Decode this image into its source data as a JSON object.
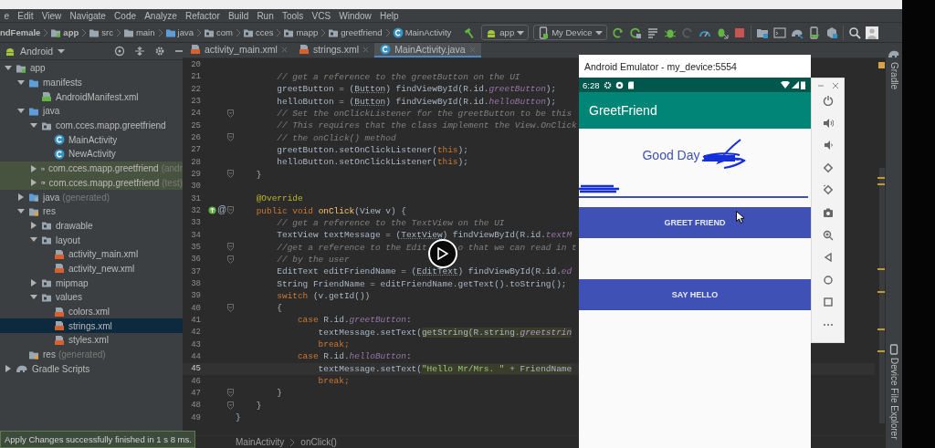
{
  "menu": [
    "e",
    "Edit",
    "View",
    "Navigate",
    "Code",
    "Analyze",
    "Refactor",
    "Build",
    "Run",
    "Tools",
    "VCS",
    "Window",
    "Help"
  ],
  "breadcrumbs": [
    {
      "label": "ndFemale",
      "kind": "project"
    },
    {
      "label": "app",
      "kind": "module"
    },
    {
      "label": "src",
      "kind": "folder"
    },
    {
      "label": "main",
      "kind": "folder"
    },
    {
      "label": "java",
      "kind": "source"
    },
    {
      "label": "com",
      "kind": "package"
    },
    {
      "label": "cces",
      "kind": "package"
    },
    {
      "label": "mapp",
      "kind": "package"
    },
    {
      "label": "greetfriend",
      "kind": "package"
    },
    {
      "label": "MainActivity",
      "kind": "class"
    }
  ],
  "toolbar": {
    "configuration": "app",
    "device": "My Device"
  },
  "project_panel": {
    "view": "Android",
    "tree": [
      {
        "label": "app",
        "kind": "module",
        "expanded": true,
        "selected": false,
        "children": [
          {
            "label": "manifests",
            "kind": "folder",
            "expanded": true,
            "selected": false,
            "children": [
              {
                "label": "AndroidManifest.xml",
                "kind": "manifest",
                "selected": false
              }
            ]
          },
          {
            "label": "java",
            "kind": "folder",
            "expanded": true,
            "selected": false,
            "children": [
              {
                "label": "com.cces.mapp.greetfriend",
                "kind": "package",
                "expanded": true,
                "selected": false,
                "children": [
                  {
                    "label": "MainActivity",
                    "kind": "class",
                    "selected": false
                  },
                  {
                    "label": "NewActivity",
                    "kind": "class",
                    "selected": false
                  }
                ]
              },
              {
                "label": "com.cces.mapp.greetfriend",
                "suffix": "(andr",
                "kind": "test_package",
                "expanded": false,
                "selected": false
              },
              {
                "label": "com.cces.mapp.greetfriend",
                "suffix": "(test)",
                "kind": "test_package",
                "expanded": false,
                "selected": false
              }
            ]
          },
          {
            "label": "java",
            "suffix": "(generated)",
            "kind": "generated",
            "expanded": false,
            "selected": false
          },
          {
            "label": "res",
            "kind": "res",
            "expanded": true,
            "selected": false,
            "children": [
              {
                "label": "drawable",
                "kind": "package",
                "expanded": false,
                "selected": false
              },
              {
                "label": "layout",
                "kind": "package",
                "expanded": true,
                "selected": false,
                "children": [
                  {
                    "label": "activity_main.xml",
                    "kind": "xml",
                    "selected": false
                  },
                  {
                    "label": "activity_new.xml",
                    "kind": "xml",
                    "selected": false
                  }
                ]
              },
              {
                "label": "mipmap",
                "kind": "package",
                "expanded": false,
                "selected": false
              },
              {
                "label": "values",
                "kind": "package",
                "expanded": true,
                "selected": false,
                "children": [
                  {
                    "label": "colors.xml",
                    "kind": "xml",
                    "selected": false
                  },
                  {
                    "label": "strings.xml",
                    "kind": "xml",
                    "selected": true
                  },
                  {
                    "label": "styles.xml",
                    "kind": "xml",
                    "selected": false
                  }
                ]
              }
            ]
          },
          {
            "label": "res",
            "suffix": "(generated)",
            "kind": "res",
            "selected": false
          }
        ]
      },
      {
        "label": "Gradle Scripts",
        "kind": "gradle",
        "expanded": false,
        "selected": false
      }
    ]
  },
  "editor_tabs": [
    {
      "label": "activity_main.xml",
      "kind": "xml",
      "selected": false
    },
    {
      "label": "strings.xml",
      "kind": "xml",
      "selected": false
    },
    {
      "label": "MainActivity.java",
      "kind": "class",
      "selected": true
    }
  ],
  "code_lines": [
    {
      "number": "20",
      "fold": false,
      "current": false
    },
    {
      "number": "21",
      "fold": false,
      "current": false,
      "tokens": [
        {
          "kind": "comment",
          "text": "        // get a reference to the greetButton on the UI"
        }
      ]
    },
    {
      "number": "22",
      "fold": false,
      "current": false,
      "tokens": [
        {
          "kind": "plain",
          "text": "        greetButton = ("
        },
        {
          "kind": "type_ref",
          "text": "Button"
        },
        {
          "kind": "plain",
          "text": ") findViewById(R.id."
        },
        {
          "kind": "field",
          "text": "greetButton"
        },
        {
          "kind": "plain",
          "text": ");"
        }
      ]
    },
    {
      "number": "23",
      "fold": false,
      "current": false,
      "tokens": [
        {
          "kind": "plain",
          "text": "        helloButton = ("
        },
        {
          "kind": "type_ref",
          "text": "Button"
        },
        {
          "kind": "plain",
          "text": ") findViewById(R.id."
        },
        {
          "kind": "field",
          "text": "helloButton"
        },
        {
          "kind": "plain",
          "text": ");"
        }
      ]
    },
    {
      "number": "24",
      "fold": true,
      "current": false,
      "tokens": [
        {
          "kind": "comment",
          "text": "        // Set the onClickListener for the greetButton to be this"
        }
      ]
    },
    {
      "number": "25",
      "fold": false,
      "current": false,
      "tokens": [
        {
          "kind": "comment",
          "text": "        // This requires that the class implement the View.OnClick"
        }
      ]
    },
    {
      "number": "26",
      "fold": true,
      "current": false,
      "tokens": [
        {
          "kind": "comment",
          "text": "        // the onClick() method"
        }
      ]
    },
    {
      "number": "27",
      "fold": false,
      "current": false,
      "tokens": [
        {
          "kind": "plain",
          "text": "        greetButton.setOnClickListener("
        },
        {
          "kind": "keyword",
          "text": "this"
        },
        {
          "kind": "plain",
          "text": ");"
        }
      ]
    },
    {
      "number": "28",
      "fold": false,
      "current": false,
      "tokens": [
        {
          "kind": "plain",
          "text": "        helloButton.setOnClickListener("
        },
        {
          "kind": "keyword",
          "text": "this"
        },
        {
          "kind": "plain",
          "text": ");"
        }
      ]
    },
    {
      "number": "29",
      "fold": true,
      "current": false,
      "tokens": [
        {
          "kind": "plain",
          "text": "    }"
        }
      ]
    },
    {
      "number": "30",
      "fold": false,
      "current": false
    },
    {
      "number": "31",
      "fold": false,
      "current": false,
      "tokens": [
        {
          "kind": "annotation",
          "text": "    @Override"
        }
      ]
    },
    {
      "number": "32",
      "fold": true,
      "current": false,
      "override": true,
      "gutter_symbol": "@",
      "tokens": [
        {
          "kind": "keyword",
          "text": "    public void "
        },
        {
          "kind": "method",
          "text": "onClick"
        },
        {
          "kind": "plain",
          "text": "(View v) {"
        }
      ]
    },
    {
      "number": "33",
      "fold": false,
      "current": false,
      "tokens": [
        {
          "kind": "comment",
          "text": "        // get a reference to the TextView on the UI"
        }
      ]
    },
    {
      "number": "34",
      "fold": false,
      "current": false,
      "tokens": [
        {
          "kind": "plain",
          "text": "        TextView textMessage = ("
        },
        {
          "kind": "type_ref",
          "text": "TextView"
        },
        {
          "kind": "plain",
          "text": ") findViewById(R.id."
        },
        {
          "kind": "field",
          "text": "textM"
        }
      ]
    },
    {
      "number": "35",
      "fold": true,
      "current": false,
      "tokens": [
        {
          "kind": "comment",
          "text": "        //get a reference to the Edit"
        }
      ],
      "continued": [
        {
          "kind": "comment",
          "text": "o that we can read in t"
        }
      ]
    },
    {
      "number": "36",
      "fold": true,
      "current": false,
      "tokens": [
        {
          "kind": "comment",
          "text": "        // by the user"
        }
      ]
    },
    {
      "number": "37",
      "fold": false,
      "current": false,
      "tokens": [
        {
          "kind": "plain",
          "text": "        EditText editFriendName = ("
        },
        {
          "kind": "type_ref",
          "text": "EditText"
        },
        {
          "kind": "plain",
          "text": ") findViewById(R.id."
        },
        {
          "kind": "field",
          "text": "ed"
        }
      ]
    },
    {
      "number": "38",
      "fold": false,
      "current": false,
      "tokens": [
        {
          "kind": "plain",
          "text": "        String FriendName = editFriendName.getText().toString();"
        }
      ]
    },
    {
      "number": "39",
      "fold": false,
      "current": false,
      "tokens": [
        {
          "kind": "keyword",
          "text": "        switch"
        },
        {
          "kind": "plain",
          "text": " (v.getId())"
        }
      ]
    },
    {
      "number": "40",
      "fold": true,
      "current": false,
      "tokens": [
        {
          "kind": "plain",
          "text": "        {"
        }
      ]
    },
    {
      "number": "41",
      "fold": false,
      "current": false,
      "tokens": [
        {
          "kind": "keyword",
          "text": "            case "
        },
        {
          "kind": "plain",
          "text": "R.id."
        },
        {
          "kind": "field",
          "text": "greetButton"
        },
        {
          "kind": "plain",
          "text": ":"
        }
      ]
    },
    {
      "number": "42",
      "fold": false,
      "current": false,
      "tokens": [
        {
          "kind": "plain",
          "text": "                textMessage.setText("
        },
        {
          "kind": "plain_hl",
          "text": "getString(R.string."
        },
        {
          "kind": "field_hl",
          "text": "greetstrin"
        }
      ]
    },
    {
      "number": "43",
      "fold": false,
      "current": false,
      "tokens": [
        {
          "kind": "keyword",
          "text": "                break;"
        }
      ]
    },
    {
      "number": "44",
      "fold": false,
      "current": false,
      "tokens": [
        {
          "kind": "keyword",
          "text": "            case "
        },
        {
          "kind": "plain",
          "text": "R.id."
        },
        {
          "kind": "field",
          "text": "helloButton"
        },
        {
          "kind": "plain",
          "text": ":"
        }
      ]
    },
    {
      "number": "45",
      "fold": false,
      "current": true,
      "tokens": [
        {
          "kind": "plain",
          "text": "                textMessage.setText("
        },
        {
          "kind": "string_hl",
          "text": "\"Hello Mr/Mrs. \""
        },
        {
          "kind": "plain_hl",
          "text": " + FriendName"
        }
      ]
    },
    {
      "number": "46",
      "fold": false,
      "current": false,
      "tokens": [
        {
          "kind": "keyword",
          "text": "                break;"
        }
      ]
    },
    {
      "number": "47",
      "fold": true,
      "current": false,
      "tokens": [
        {
          "kind": "plain",
          "text": "        }"
        }
      ]
    },
    {
      "number": "48",
      "fold": true,
      "current": false,
      "tokens": [
        {
          "kind": "plain",
          "text": "    }"
        }
      ]
    },
    {
      "number": "49",
      "fold": false,
      "current": false,
      "tokens": [
        {
          "kind": "plain",
          "text": "}"
        }
      ]
    }
  ],
  "editor_breadcrumbs": [
    "MainActivity",
    "onClick()"
  ],
  "tool_windows": [
    "Gradle",
    "Device File Explorer"
  ],
  "emulator": {
    "title": "Android Emulator - my_device:5554",
    "time": "6:28",
    "app_title": "GreetFriend",
    "greeting": "Good Day",
    "buttons": [
      "GREET FRIEND",
      "SAY HELLO"
    ]
  },
  "notification": "Apply Changes successfully finished in 1 s 8 ms."
}
